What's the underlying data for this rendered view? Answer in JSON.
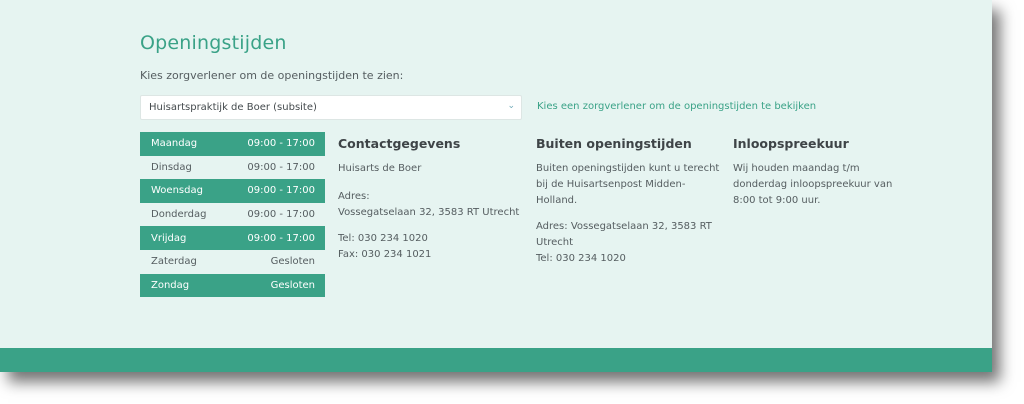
{
  "page": {
    "title": "Openingstijden",
    "instruction": "Kies zorgverlener om de openingstijden te zien:"
  },
  "select": {
    "value": "Huisartspraktijk de Boer (subsite)",
    "hint": "Kies een zorgverlener om de openingstijden te bekijken",
    "chevron": "chevron-down-icon"
  },
  "hours": [
    {
      "day": "Maandag",
      "time": "09:00 - 17:00"
    },
    {
      "day": "Dinsdag",
      "time": "09:00 - 17:00"
    },
    {
      "day": "Woensdag",
      "time": "09:00 - 17:00"
    },
    {
      "day": "Donderdag",
      "time": "09:00 - 17:00"
    },
    {
      "day": "Vrijdag",
      "time": "09:00 - 17:00"
    },
    {
      "day": "Zaterdag",
      "time": "Gesloten"
    },
    {
      "day": "Zondag",
      "time": "Gesloten"
    }
  ],
  "contact": {
    "heading": "Contactgegevens",
    "name": "Huisarts de Boer",
    "address_label": "Adres:",
    "address": "Vossegatselaan 32, 3583 RT Utrecht",
    "tel": "Tel: 030 234 1020",
    "fax": "Fax: 030 234 1021"
  },
  "after_hours": {
    "heading": "Buiten openingstijden",
    "text": "Buiten openingstijden kunt u terecht bij de Huisartsenpost Midden-Holland.",
    "address": "Adres: Vossegatselaan 32, 3583 RT Utrecht",
    "tel": "Tel: 030 234 1020"
  },
  "walk_in": {
    "heading": "Inloopspreekuur",
    "text": "Wij houden maandag t/m donderdag inloopspreekuur van 8:00 tot 9:00 uur."
  },
  "colors": {
    "accent": "#3aa287",
    "background": "#e6f4f1",
    "text": "#555d60"
  }
}
